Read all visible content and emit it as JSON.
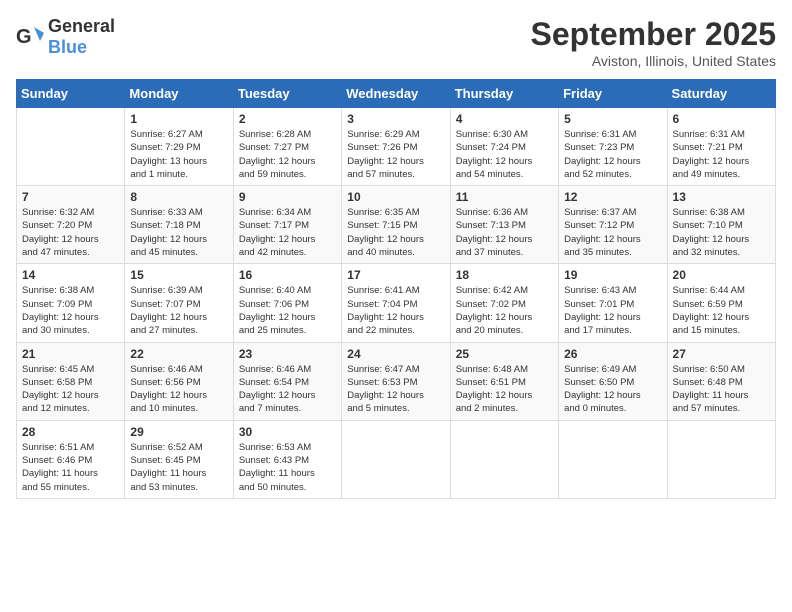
{
  "logo": {
    "text_general": "General",
    "text_blue": "Blue"
  },
  "header": {
    "month": "September 2025",
    "location": "Aviston, Illinois, United States"
  },
  "weekdays": [
    "Sunday",
    "Monday",
    "Tuesday",
    "Wednesday",
    "Thursday",
    "Friday",
    "Saturday"
  ],
  "weeks": [
    [
      {
        "day": "",
        "info": ""
      },
      {
        "day": "1",
        "info": "Sunrise: 6:27 AM\nSunset: 7:29 PM\nDaylight: 13 hours\nand 1 minute."
      },
      {
        "day": "2",
        "info": "Sunrise: 6:28 AM\nSunset: 7:27 PM\nDaylight: 12 hours\nand 59 minutes."
      },
      {
        "day": "3",
        "info": "Sunrise: 6:29 AM\nSunset: 7:26 PM\nDaylight: 12 hours\nand 57 minutes."
      },
      {
        "day": "4",
        "info": "Sunrise: 6:30 AM\nSunset: 7:24 PM\nDaylight: 12 hours\nand 54 minutes."
      },
      {
        "day": "5",
        "info": "Sunrise: 6:31 AM\nSunset: 7:23 PM\nDaylight: 12 hours\nand 52 minutes."
      },
      {
        "day": "6",
        "info": "Sunrise: 6:31 AM\nSunset: 7:21 PM\nDaylight: 12 hours\nand 49 minutes."
      }
    ],
    [
      {
        "day": "7",
        "info": "Sunrise: 6:32 AM\nSunset: 7:20 PM\nDaylight: 12 hours\nand 47 minutes."
      },
      {
        "day": "8",
        "info": "Sunrise: 6:33 AM\nSunset: 7:18 PM\nDaylight: 12 hours\nand 45 minutes."
      },
      {
        "day": "9",
        "info": "Sunrise: 6:34 AM\nSunset: 7:17 PM\nDaylight: 12 hours\nand 42 minutes."
      },
      {
        "day": "10",
        "info": "Sunrise: 6:35 AM\nSunset: 7:15 PM\nDaylight: 12 hours\nand 40 minutes."
      },
      {
        "day": "11",
        "info": "Sunrise: 6:36 AM\nSunset: 7:13 PM\nDaylight: 12 hours\nand 37 minutes."
      },
      {
        "day": "12",
        "info": "Sunrise: 6:37 AM\nSunset: 7:12 PM\nDaylight: 12 hours\nand 35 minutes."
      },
      {
        "day": "13",
        "info": "Sunrise: 6:38 AM\nSunset: 7:10 PM\nDaylight: 12 hours\nand 32 minutes."
      }
    ],
    [
      {
        "day": "14",
        "info": "Sunrise: 6:38 AM\nSunset: 7:09 PM\nDaylight: 12 hours\nand 30 minutes."
      },
      {
        "day": "15",
        "info": "Sunrise: 6:39 AM\nSunset: 7:07 PM\nDaylight: 12 hours\nand 27 minutes."
      },
      {
        "day": "16",
        "info": "Sunrise: 6:40 AM\nSunset: 7:06 PM\nDaylight: 12 hours\nand 25 minutes."
      },
      {
        "day": "17",
        "info": "Sunrise: 6:41 AM\nSunset: 7:04 PM\nDaylight: 12 hours\nand 22 minutes."
      },
      {
        "day": "18",
        "info": "Sunrise: 6:42 AM\nSunset: 7:02 PM\nDaylight: 12 hours\nand 20 minutes."
      },
      {
        "day": "19",
        "info": "Sunrise: 6:43 AM\nSunset: 7:01 PM\nDaylight: 12 hours\nand 17 minutes."
      },
      {
        "day": "20",
        "info": "Sunrise: 6:44 AM\nSunset: 6:59 PM\nDaylight: 12 hours\nand 15 minutes."
      }
    ],
    [
      {
        "day": "21",
        "info": "Sunrise: 6:45 AM\nSunset: 6:58 PM\nDaylight: 12 hours\nand 12 minutes."
      },
      {
        "day": "22",
        "info": "Sunrise: 6:46 AM\nSunset: 6:56 PM\nDaylight: 12 hours\nand 10 minutes."
      },
      {
        "day": "23",
        "info": "Sunrise: 6:46 AM\nSunset: 6:54 PM\nDaylight: 12 hours\nand 7 minutes."
      },
      {
        "day": "24",
        "info": "Sunrise: 6:47 AM\nSunset: 6:53 PM\nDaylight: 12 hours\nand 5 minutes."
      },
      {
        "day": "25",
        "info": "Sunrise: 6:48 AM\nSunset: 6:51 PM\nDaylight: 12 hours\nand 2 minutes."
      },
      {
        "day": "26",
        "info": "Sunrise: 6:49 AM\nSunset: 6:50 PM\nDaylight: 12 hours\nand 0 minutes."
      },
      {
        "day": "27",
        "info": "Sunrise: 6:50 AM\nSunset: 6:48 PM\nDaylight: 11 hours\nand 57 minutes."
      }
    ],
    [
      {
        "day": "28",
        "info": "Sunrise: 6:51 AM\nSunset: 6:46 PM\nDaylight: 11 hours\nand 55 minutes."
      },
      {
        "day": "29",
        "info": "Sunrise: 6:52 AM\nSunset: 6:45 PM\nDaylight: 11 hours\nand 53 minutes."
      },
      {
        "day": "30",
        "info": "Sunrise: 6:53 AM\nSunset: 6:43 PM\nDaylight: 11 hours\nand 50 minutes."
      },
      {
        "day": "",
        "info": ""
      },
      {
        "day": "",
        "info": ""
      },
      {
        "day": "",
        "info": ""
      },
      {
        "day": "",
        "info": ""
      }
    ]
  ]
}
